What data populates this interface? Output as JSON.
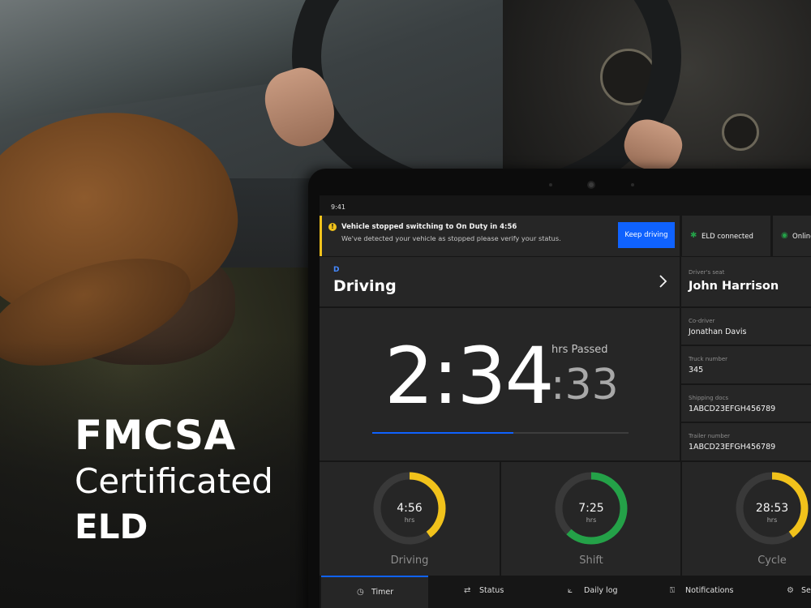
{
  "headline": {
    "line1": "FMCSA",
    "line2": "Certificated",
    "line3": "ELD"
  },
  "device": {
    "time": "9:41"
  },
  "alert": {
    "title": "Vehicle stopped switching to On Duty in 4:56",
    "message": "We've detected your vehicle as stopped please verify your status.",
    "action_label": "Keep driving",
    "icon": "warning-icon",
    "color": "#f1c21b"
  },
  "connection": {
    "eld_label": "ELD connected",
    "online_label": "Online",
    "status_color": "#24a148"
  },
  "duty_status": {
    "code": "D",
    "label": "Driving"
  },
  "timer": {
    "time": "2:34",
    "seconds": ":33",
    "caption": "hrs Passed",
    "progress": 0.55
  },
  "driver": {
    "seat_label": "Driver's seat",
    "seat_value": "John Harrison",
    "codriver_label": "Co-driver",
    "codriver_value": "Jonathan Davis",
    "truck_label": "Truck number",
    "truck_value": "345",
    "shipping_label": "Shipping docs",
    "shipping_value": "1ABCD23EFGH456789",
    "trailer_label": "Trailer number",
    "trailer_value": "1ABCD23EFGH456789"
  },
  "gauges": [
    {
      "value": "4:56",
      "unit": "hrs",
      "label": "Driving",
      "fraction": 0.4,
      "color": "#f1c21b"
    },
    {
      "value": "7:25",
      "unit": "hrs",
      "label": "Shift",
      "fraction": 0.62,
      "color": "#24a148"
    },
    {
      "value": "28:53",
      "unit": "hrs",
      "label": "Cycle",
      "fraction": 0.4,
      "color": "#f1c21b"
    }
  ],
  "nav": {
    "timer": "Timer",
    "status": "Status",
    "daily_log": "Daily log",
    "notifications": "Notifications",
    "settings": "Se",
    "active": "timer",
    "accent": "#0f62fe"
  }
}
